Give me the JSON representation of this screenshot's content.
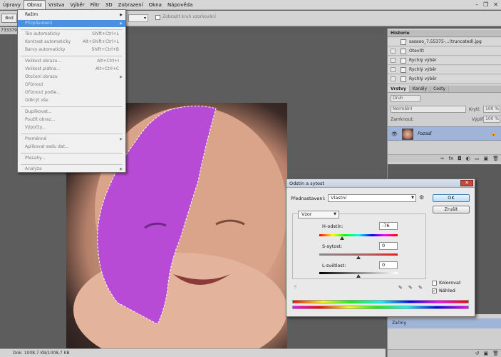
{
  "menubar": {
    "items": [
      "Úpravy",
      "Obraz",
      "Vrstva",
      "Výběr",
      "Filtr",
      "3D",
      "Zobrazení",
      "Okna",
      "Nápověda"
    ],
    "active": "Obraz"
  },
  "options": {
    "mode": "Bod",
    "checkbox_label": "Zobrazit kruh vzorkování"
  },
  "doc_tab": "733379",
  "obraz_menu": {
    "items": [
      {
        "label": "Režim",
        "shortcut": "",
        "submenu": true,
        "enabled": true
      },
      {
        "label": "Přizpůsobení",
        "shortcut": "",
        "submenu": true,
        "enabled": true,
        "highlight": true
      },
      {
        "label": "Tón automaticky",
        "shortcut": "Shift+Ctrl+L"
      },
      {
        "label": "Kontrast automaticky",
        "shortcut": "Alt+Shift+Ctrl+L"
      },
      {
        "label": "Barvy automaticky",
        "shortcut": "Shift+Ctrl+B"
      },
      {
        "label": "Velikost obrazu...",
        "shortcut": "Alt+Ctrl+I"
      },
      {
        "label": "Velikost plátna...",
        "shortcut": "Alt+Ctrl+C"
      },
      {
        "label": "Otočení obrazu",
        "shortcut": "",
        "submenu": true
      },
      {
        "label": "Oříznout",
        "shortcut": ""
      },
      {
        "label": "Oříznout podle...",
        "shortcut": ""
      },
      {
        "label": "Odkrýt vše",
        "shortcut": ""
      },
      {
        "label": "Duplikovat...",
        "shortcut": ""
      },
      {
        "label": "Použít obraz...",
        "shortcut": ""
      },
      {
        "label": "Výpočty...",
        "shortcut": ""
      },
      {
        "label": "Proměnné",
        "shortcut": "",
        "submenu": true
      },
      {
        "label": "Aplikovat sadu dat...",
        "shortcut": ""
      },
      {
        "label": "Přesahy...",
        "shortcut": ""
      },
      {
        "label": "Analýza",
        "shortcut": "",
        "submenu": true
      }
    ]
  },
  "history_panel": {
    "title": "Historie",
    "items": [
      "Otevřít",
      "Rychlý výběr",
      "Rychlý výběr",
      "Rychlý výběr"
    ],
    "snapshot_label": "sasaoo_7.55375-...(truncated).jpg"
  },
  "layers_panel": {
    "tabs": [
      "Vrstvy",
      "Kanály",
      "Cesty"
    ],
    "kind_placeholder": "Druh",
    "blend_mode": "Normální",
    "opacity_label": "Krytí:",
    "opacity_value": "100 %",
    "lock_label": "Zamknout:",
    "fill_label": "Výplň:",
    "fill_value": "100 %",
    "layer_name": "Pozadí"
  },
  "bottom_panel": {
    "item": "Začiny"
  },
  "status": {
    "doc_info": "Dok: 1008,7 KB/1008,7 KB"
  },
  "dialog": {
    "title": "Odstín a sytost",
    "preset_label": "Přednastavení:",
    "preset_value": "Vlastní",
    "ok_label": "OK",
    "cancel_label": "Zrušit",
    "channel_value": "Vzor",
    "hue_label": "H-odstín:",
    "hue_value": "-76",
    "sat_label": "S-sytost:",
    "sat_value": "0",
    "light_label": "L-světlost:",
    "light_value": "0",
    "colorize_label": "Kolorovat",
    "preview_label": "Náhled",
    "preview_checked": true,
    "colorize_checked": false,
    "slider_levels": {
      "hue": -76,
      "saturation": 0,
      "lightness": 0
    },
    "accent_color": "#b84bd6"
  }
}
